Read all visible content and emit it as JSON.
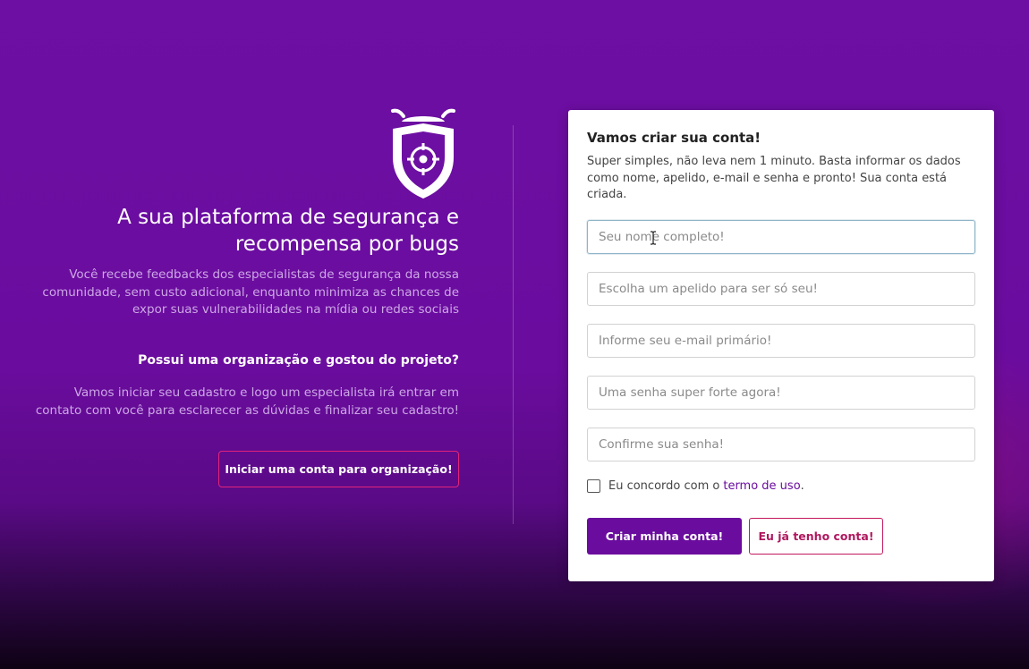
{
  "hero": {
    "logo_icon": "bug-shield-target-icon",
    "headline": "A sua plataforma de segurança e recompensa por bugs",
    "description": "Você recebe feedbacks dos especialistas de segurança da nossa comunidade, sem custo adicional, enquanto minimiza as chances de expor suas vulnerabilidades na mídia ou redes sociais"
  },
  "organization": {
    "title": "Possui uma organização e gostou do projeto?",
    "text": "Vamos iniciar seu cadastro e logo um especialista irá entrar em contato com você para esclarecer as dúvidas e finalizar seu cadastro!",
    "button_label": "Iniciar uma conta para organização!"
  },
  "signup": {
    "title": "Vamos criar sua conta!",
    "description": "Super simples, não leva nem 1 minuto. Basta informar os dados como nome, apelido, e-mail e senha e pronto! Sua conta está criada.",
    "fields": {
      "full_name": {
        "placeholder": "Seu nome completo!",
        "value": ""
      },
      "nickname": {
        "placeholder": "Escolha um apelido para ser só seu!",
        "value": ""
      },
      "email": {
        "placeholder": "Informe seu e-mail primário!",
        "value": ""
      },
      "password": {
        "placeholder": "Uma senha super forte agora!",
        "value": ""
      },
      "password_confirm": {
        "placeholder": "Confirme sua senha!",
        "value": ""
      }
    },
    "terms": {
      "checked": false,
      "label": "Eu concordo com o",
      "link_text": "termo de uso",
      "suffix": "."
    },
    "create_button": "Criar minha conta!",
    "login_button": "Eu já tenho conta!"
  },
  "colors": {
    "background": "#6a0c9e",
    "primary": "#6a0c9e",
    "accent": "#e2247a",
    "secondary_text": "#cda7e6"
  }
}
